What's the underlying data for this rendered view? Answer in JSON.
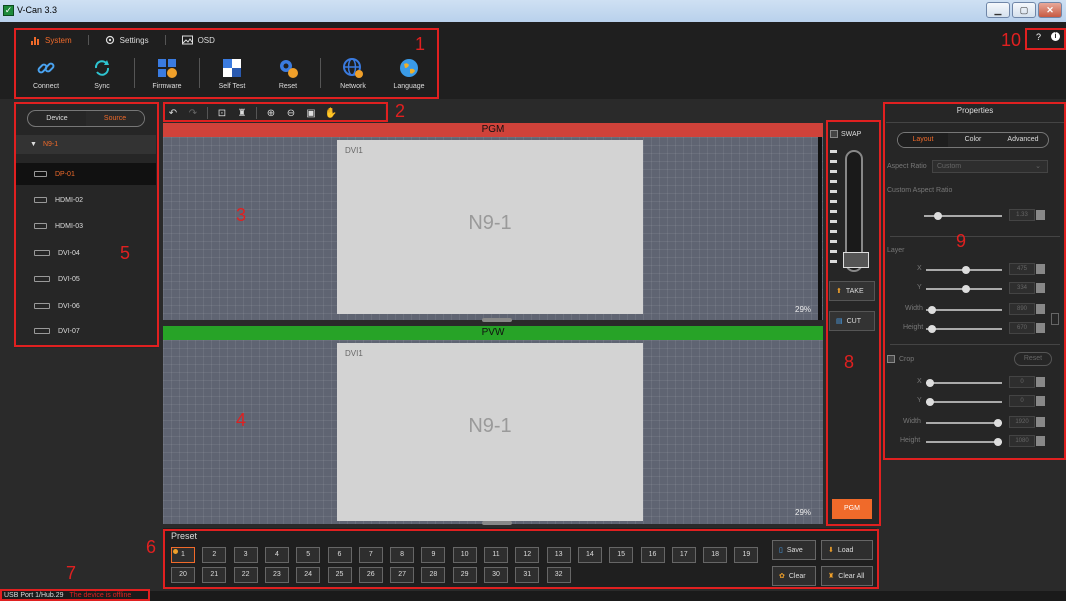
{
  "window": {
    "title": "V-Can 3.3",
    "controls": [
      "minimize",
      "maximize",
      "close"
    ]
  },
  "menu": {
    "tabs": [
      {
        "label": "System",
        "icon": "system-icon",
        "active": true
      },
      {
        "label": "Settings",
        "icon": "gear-icon",
        "active": false
      },
      {
        "label": "OSD",
        "icon": "image-icon",
        "active": false
      }
    ],
    "tools": [
      {
        "label": "Connect",
        "icon": "link-icon"
      },
      {
        "label": "Sync",
        "icon": "sync-icon"
      },
      {
        "label": "Firmware",
        "icon": "firmware-icon"
      },
      {
        "label": "Self Test",
        "icon": "selftest-icon"
      },
      {
        "label": "Reset",
        "icon": "reset-icon"
      },
      {
        "label": "Network",
        "icon": "network-icon"
      },
      {
        "label": "Language",
        "icon": "globe-icon"
      }
    ]
  },
  "help": {
    "question": "?",
    "info": "i"
  },
  "annotations": [
    "1",
    "2",
    "3",
    "4",
    "5",
    "6",
    "7",
    "8",
    "9",
    "10"
  ],
  "left_panel": {
    "segments": [
      {
        "label": "Device",
        "active": false
      },
      {
        "label": "Source",
        "active": true
      }
    ],
    "device_name": "N9-1",
    "sources": [
      {
        "label": "DP-01",
        "selected": true
      },
      {
        "label": "HDMI-02",
        "selected": false
      },
      {
        "label": "HDMI-03",
        "selected": false
      },
      {
        "label": "DVI-04",
        "selected": false
      },
      {
        "label": "DVI-05",
        "selected": false
      },
      {
        "label": "DVI-06",
        "selected": false
      },
      {
        "label": "DVI-07",
        "selected": false
      }
    ]
  },
  "canvas_toolbar": [
    "undo-icon",
    "redo-icon",
    "lock-icon",
    "clean-icon",
    "zoom-in-icon",
    "zoom-out-icon",
    "fit-icon",
    "hand-icon"
  ],
  "pgm": {
    "label": "PGM",
    "layer_name": "DVI1",
    "screen_name": "N9-1",
    "zoom": "29%",
    "color": "#d0423a"
  },
  "pvw": {
    "label": "PVW",
    "layer_name": "DVI1",
    "screen_name": "N9-1",
    "zoom": "29%",
    "color": "#27a327"
  },
  "control": {
    "swap_label": "SWAP",
    "take_label": "TAKE",
    "cut_label": "CUT",
    "pgm_button": "PGM"
  },
  "preset": {
    "title": "Preset",
    "row1": [
      "1",
      "2",
      "3",
      "4",
      "5",
      "6",
      "7",
      "8",
      "9",
      "10",
      "11",
      "12",
      "13",
      "14",
      "15",
      "16",
      "17",
      "18",
      "19"
    ],
    "row2": [
      "20",
      "21",
      "22",
      "23",
      "24",
      "25",
      "26",
      "27",
      "28",
      "29",
      "30",
      "31",
      "32"
    ],
    "save_label": "Save",
    "load_label": "Load",
    "clear_label": "Clear",
    "clear_all_label": "Clear All"
  },
  "status": {
    "port": "USB Port 1/Hub.29",
    "message": "The device is offline"
  },
  "properties": {
    "title": "Properties",
    "tabs": [
      {
        "label": "Layout",
        "active": true
      },
      {
        "label": "Color",
        "active": false
      },
      {
        "label": "Advanced",
        "active": false
      }
    ],
    "aspect_ratio_label": "Aspect Ratio",
    "aspect_ratio_value": "Custom",
    "custom_aspect_label": "Custom Aspect Ratio",
    "custom_aspect_value": "1.33",
    "layer_label": "Layer",
    "x_label": "X",
    "x_value": "475",
    "y_label": "Y",
    "y_value": "334",
    "width_label": "Width",
    "width_value": "890",
    "height_label": "Height",
    "height_value": "670",
    "crop_label": "Crop",
    "reset_label": "Reset",
    "cx_label": "X",
    "cx_value": "0",
    "cy_label": "Y",
    "cy_value": "0",
    "cwidth_label": "Width",
    "cwidth_value": "1920",
    "cheight_label": "Height",
    "cheight_value": "1080"
  },
  "accent": "#f06a2a"
}
